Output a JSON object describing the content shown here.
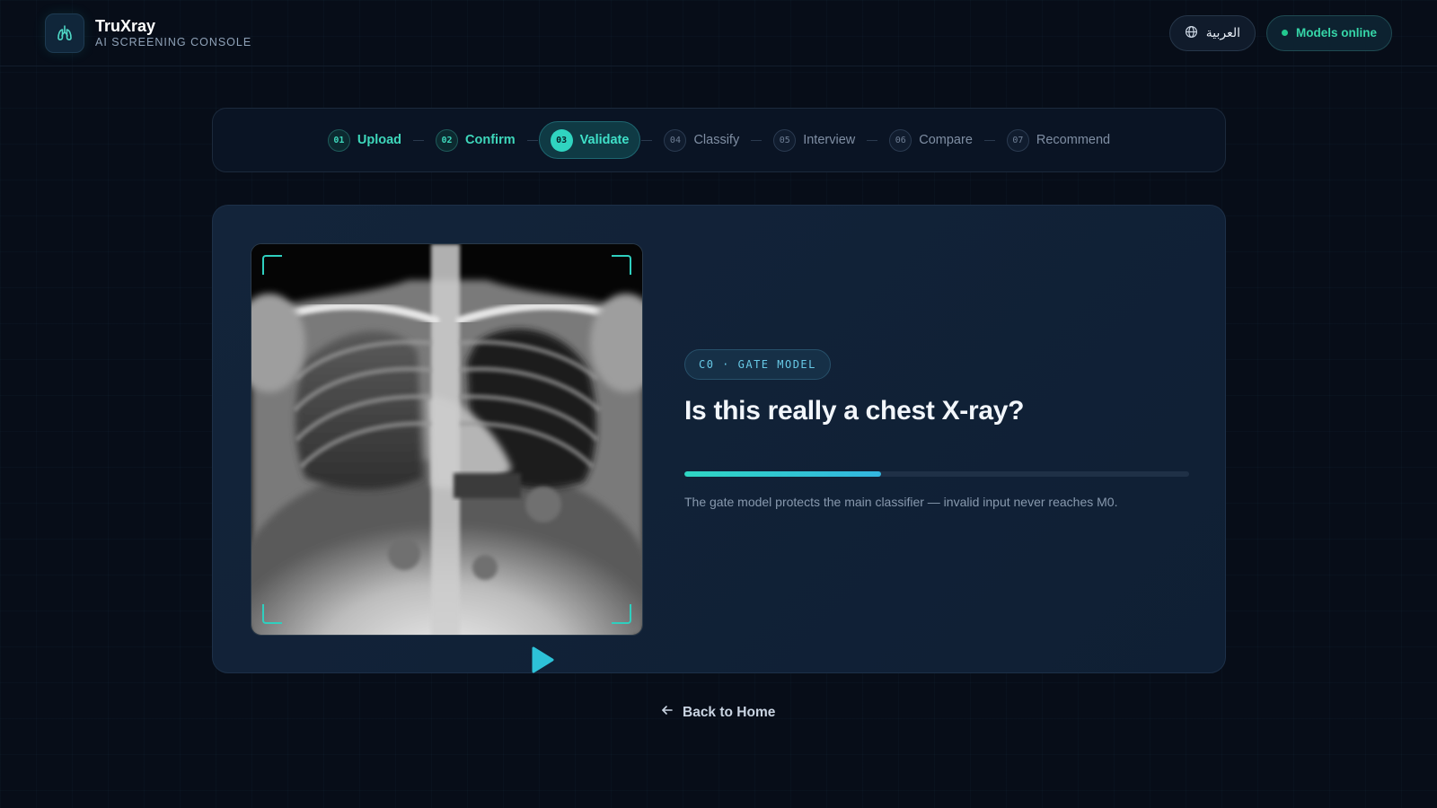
{
  "header": {
    "brand_name": "TruXray",
    "brand_subtitle": "AI SCREENING CONSOLE",
    "language_label": "العربية",
    "status_label": "Models online"
  },
  "stepper": {
    "steps": [
      {
        "num": "01",
        "label": "Upload",
        "state": "done"
      },
      {
        "num": "02",
        "label": "Confirm",
        "state": "done"
      },
      {
        "num": "03",
        "label": "Validate",
        "state": "active"
      },
      {
        "num": "04",
        "label": "Classify",
        "state": "todo"
      },
      {
        "num": "05",
        "label": "Interview",
        "state": "todo"
      },
      {
        "num": "06",
        "label": "Compare",
        "state": "todo"
      },
      {
        "num": "07",
        "label": "Recommend",
        "state": "todo"
      }
    ]
  },
  "main": {
    "gate_tag": "C0 · GATE MODEL",
    "title": "Is this really a chest X-ray?",
    "progress": 0.39,
    "description": "The gate model protects the main classifier — invalid input never reaches M0."
  },
  "footer": {
    "back_label": "Back to Home"
  },
  "colors": {
    "accent": "#30d4c0",
    "background": "#070d18",
    "card": "#13243a",
    "status": "#22c98f"
  },
  "icons": {
    "logo": "lungs-icon",
    "language": "globe-icon",
    "back": "arrow-left-icon",
    "play": "play-icon"
  }
}
